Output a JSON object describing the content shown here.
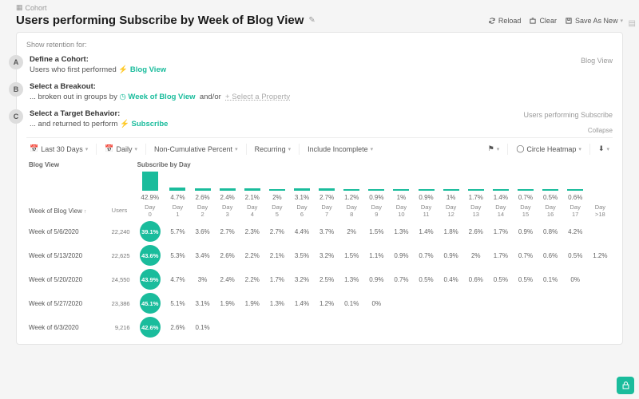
{
  "breadcrumb": "Cohort",
  "title": "Users performing Subscribe by Week of Blog View",
  "header_buttons": {
    "reload": "Reload",
    "clear": "Clear",
    "save_as_new": "Save As New"
  },
  "show_retention_for": "Show retention for:",
  "steps": {
    "a": {
      "letter": "A",
      "label": "Define a Cohort:",
      "sub_prefix": "Users who first performed",
      "link": "Blog View",
      "right": "Blog View"
    },
    "b": {
      "letter": "B",
      "label": "Select a Breakout:",
      "sub_prefix": "... broken out in groups by",
      "link": "Week of Blog View",
      "and_or": "and/or",
      "add_text": "+ Select a Property"
    },
    "c": {
      "letter": "C",
      "label": "Select a Target Behavior:",
      "sub_prefix": "... and returned to perform",
      "link": "Subscribe",
      "right": "Users performing Subscribe"
    }
  },
  "collapse": "Collapse",
  "toolbar": {
    "range": "Last 30 Days",
    "granularity": "Daily",
    "mode": "Non-Cumulative Percent",
    "recurring": "Recurring",
    "include_incomplete": "Include Incomplete",
    "chart": "Circle Heatmap"
  },
  "table": {
    "left_section": "Blog View",
    "right_section": "Subscribe by Day",
    "week_col": "Week of Blog View",
    "users_col": "Users",
    "day_prefix": "Day",
    "last_col": "Day >18",
    "day_indices": [
      0,
      1,
      2,
      3,
      4,
      5,
      6,
      7,
      8,
      9,
      10,
      11,
      12,
      13,
      14,
      15,
      16,
      17
    ],
    "bars_pct": [
      "42.9%",
      "4.7%",
      "2.6%",
      "2.4%",
      "2.1%",
      "2%",
      "3.1%",
      "2.7%",
      "1.2%",
      "0.9%",
      "1%",
      "0.9%",
      "1%",
      "1.7%",
      "1.4%",
      "0.7%",
      "0.5%",
      "0.6%",
      ""
    ],
    "bars_height": [
      24,
      4,
      3,
      3,
      3,
      2,
      3,
      3,
      2,
      2,
      2,
      2,
      2,
      2,
      2,
      2,
      2,
      2,
      0
    ],
    "rows": [
      {
        "label": "Week of 5/6/2020",
        "users": "22,240",
        "vals": [
          "39.1%",
          "5.7%",
          "3.6%",
          "2.7%",
          "2.3%",
          "2.7%",
          "4.4%",
          "3.7%",
          "2%",
          "1.5%",
          "1.3%",
          "1.4%",
          "1.8%",
          "2.6%",
          "1.7%",
          "0.9%",
          "0.8%",
          "4.2%"
        ]
      },
      {
        "label": "Week of 5/13/2020",
        "users": "22,625",
        "vals": [
          "43.6%",
          "5.3%",
          "3.4%",
          "2.6%",
          "2.2%",
          "2.1%",
          "3.5%",
          "3.2%",
          "1.5%",
          "1.1%",
          "0.9%",
          "0.7%",
          "0.9%",
          "2%",
          "1.7%",
          "0.7%",
          "0.6%",
          "0.5%",
          "1.2%"
        ]
      },
      {
        "label": "Week of 5/20/2020",
        "users": "24,550",
        "vals": [
          "43.9%",
          "4.7%",
          "3%",
          "2.4%",
          "2.2%",
          "1.7%",
          "3.2%",
          "2.5%",
          "1.3%",
          "0.9%",
          "0.7%",
          "0.5%",
          "0.4%",
          "0.6%",
          "0.5%",
          "0.5%",
          "0.1%",
          "0%"
        ]
      },
      {
        "label": "Week of 5/27/2020",
        "users": "23,386",
        "vals": [
          "45.1%",
          "5.1%",
          "3.1%",
          "1.9%",
          "1.9%",
          "1.3%",
          "1.4%",
          "1.2%",
          "0.1%",
          "0%"
        ]
      },
      {
        "label": "Week of 6/3/2020",
        "users": "9,216",
        "vals": [
          "42.6%",
          "2.6%",
          "0.1%"
        ]
      }
    ]
  }
}
